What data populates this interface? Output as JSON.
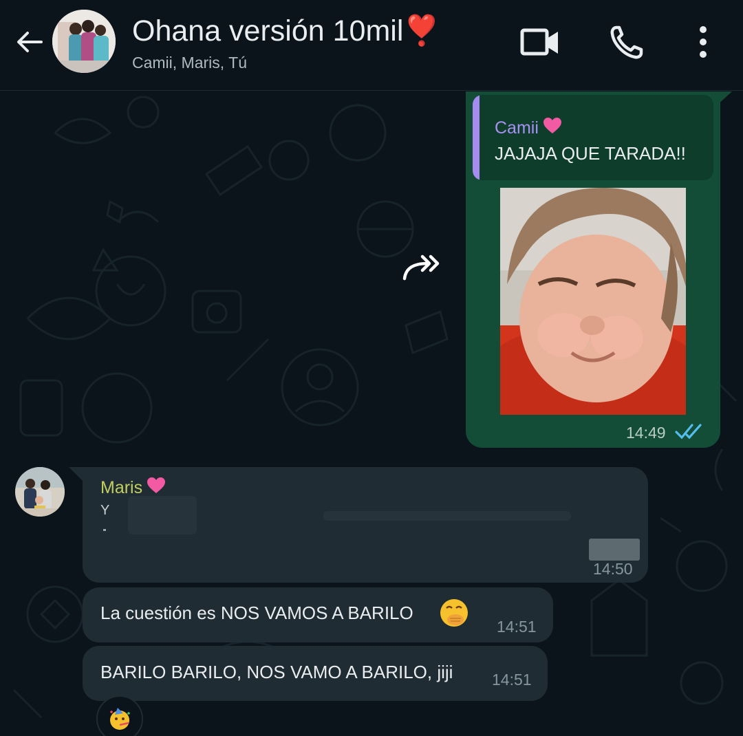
{
  "header": {
    "back_label": "back",
    "title": "Ohana versión 10mil❣️",
    "subtitle": "Camii, Maris, Tú",
    "icons": [
      "back-arrow-icon",
      "video-call-icon",
      "voice-call-icon",
      "more-options-icon"
    ]
  },
  "messages": [
    {
      "type": "outgoing-reply",
      "quoted_sender": "Camii",
      "quoted_sender_suffix": "💗",
      "quoted_text": "JAJAJA QUE TARADA!!",
      "media": "image",
      "time": "14:49",
      "status": "read"
    },
    {
      "type": "incoming",
      "sender": "Maris",
      "sender_suffix": "💗",
      "text_fragment": "Y",
      "text": "",
      "time": "14:50"
    },
    {
      "type": "incoming",
      "text": "La cuestión es NOS VAMOS A BARILO",
      "emoji": "🤭",
      "time": "14:51"
    },
    {
      "type": "incoming",
      "text": "BARILO BARILO, NOS VAMO A BARILO, jiji",
      "time": "14:51",
      "reaction": "🥳"
    }
  ],
  "colors": {
    "background": "#0b141a",
    "outgoing_bubble": "#144d37",
    "incoming_bubble": "#202c33",
    "quote_bar": "#a58cf0",
    "sender_maris": "#c2cf5f",
    "read_ticks": "#53bdeb"
  }
}
